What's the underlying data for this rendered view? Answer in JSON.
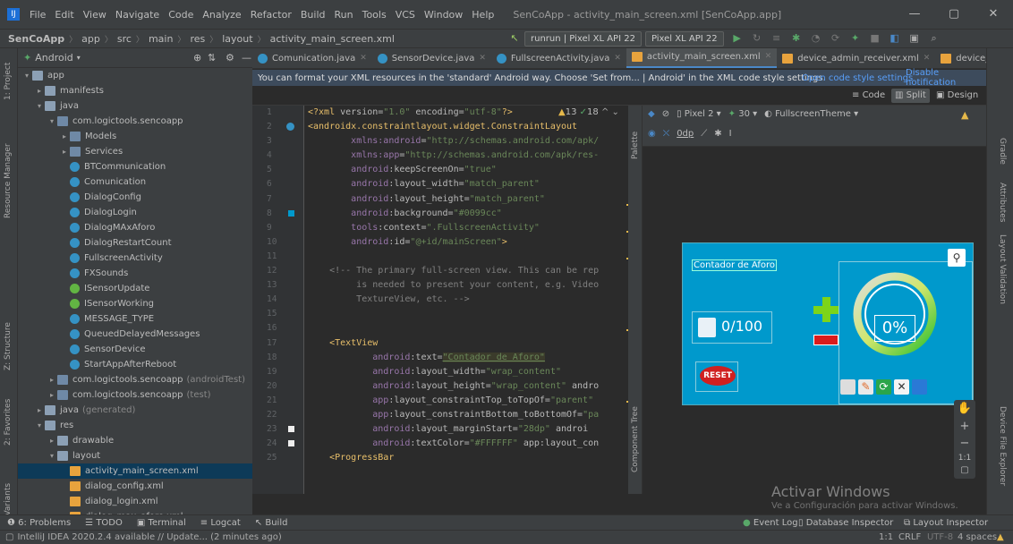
{
  "window": {
    "title": "SenCoApp - activity_main_screen.xml [SenCoApp.app]"
  },
  "menu": [
    "File",
    "Edit",
    "View",
    "Navigate",
    "Code",
    "Analyze",
    "Refactor",
    "Build",
    "Run",
    "Tools",
    "VCS",
    "Window",
    "Help"
  ],
  "breadcrumb": [
    "SenCoApp",
    "app",
    "src",
    "main",
    "res",
    "layout",
    "activity_main_screen.xml"
  ],
  "toolbar": {
    "run_config": "runrun | Pixel XL API 22",
    "device": "Pixel XL API 22"
  },
  "project_panel": {
    "view": "Android"
  },
  "tree": [
    {
      "label": "app",
      "level": 0,
      "icon": "fold",
      "arrow": "▾"
    },
    {
      "label": "manifests",
      "level": 1,
      "icon": "fold",
      "arrow": "▸"
    },
    {
      "label": "java",
      "level": 1,
      "icon": "fold",
      "arrow": "▾"
    },
    {
      "label": "com.logictools.sencoapp",
      "level": 2,
      "icon": "pkg",
      "arrow": "▾"
    },
    {
      "label": "Models",
      "level": 3,
      "icon": "pkg",
      "arrow": "▸"
    },
    {
      "label": "Services",
      "level": 3,
      "icon": "pkg",
      "arrow": "▸"
    },
    {
      "label": "BTCommunication",
      "level": 3,
      "icon": "cls",
      "arrow": ""
    },
    {
      "label": "Comunication",
      "level": 3,
      "icon": "cls",
      "arrow": ""
    },
    {
      "label": "DialogConfig",
      "level": 3,
      "icon": "cls",
      "arrow": ""
    },
    {
      "label": "DialogLogin",
      "level": 3,
      "icon": "cls",
      "arrow": ""
    },
    {
      "label": "DialogMAxAforo",
      "level": 3,
      "icon": "cls",
      "arrow": ""
    },
    {
      "label": "DialogRestartCount",
      "level": 3,
      "icon": "cls",
      "arrow": ""
    },
    {
      "label": "FullscreenActivity",
      "level": 3,
      "icon": "cls",
      "arrow": ""
    },
    {
      "label": "FXSounds",
      "level": 3,
      "icon": "cls",
      "arrow": ""
    },
    {
      "label": "ISensorUpdate",
      "level": 3,
      "icon": "itf",
      "arrow": ""
    },
    {
      "label": "ISensorWorking",
      "level": 3,
      "icon": "itf",
      "arrow": ""
    },
    {
      "label": "MESSAGE_TYPE",
      "level": 3,
      "icon": "cls",
      "arrow": ""
    },
    {
      "label": "QueuedDelayedMessages",
      "level": 3,
      "icon": "cls",
      "arrow": ""
    },
    {
      "label": "SensorDevice",
      "level": 3,
      "icon": "cls",
      "arrow": ""
    },
    {
      "label": "StartAppAfterReboot",
      "level": 3,
      "icon": "cls",
      "arrow": ""
    },
    {
      "label": "com.logictools.sencoapp",
      "suffix": "(androidTest)",
      "level": 2,
      "icon": "pkg",
      "arrow": "▸"
    },
    {
      "label": "com.logictools.sencoapp",
      "suffix": "(test)",
      "level": 2,
      "icon": "pkg",
      "arrow": "▸"
    },
    {
      "label": "java",
      "suffix": "(generated)",
      "level": 1,
      "icon": "fold",
      "arrow": "▸"
    },
    {
      "label": "res",
      "level": 1,
      "icon": "fold",
      "arrow": "▾"
    },
    {
      "label": "drawable",
      "level": 2,
      "icon": "fold",
      "arrow": "▸"
    },
    {
      "label": "layout",
      "level": 2,
      "icon": "fold",
      "arrow": "▾"
    },
    {
      "label": "activity_main_screen.xml",
      "level": 3,
      "icon": "xml",
      "arrow": "",
      "selected": true
    },
    {
      "label": "dialog_config.xml",
      "level": 3,
      "icon": "xml",
      "arrow": ""
    },
    {
      "label": "dialog_login.xml",
      "level": 3,
      "icon": "xml",
      "arrow": ""
    },
    {
      "label": "dialog_max_aforo.xml",
      "level": 3,
      "icon": "xml",
      "arrow": ""
    }
  ],
  "tabs": [
    {
      "label": "Comunication.java",
      "active": false
    },
    {
      "label": "SensorDevice.java",
      "active": false
    },
    {
      "label": "FullscreenActivity.java",
      "active": false
    },
    {
      "label": "activity_main_screen.xml",
      "active": true
    },
    {
      "label": "device_admin_receiver.xml",
      "active": false
    },
    {
      "label": "device_filter.xml",
      "active": false
    }
  ],
  "notification": {
    "text": "You can format your XML resources in the 'standard' Android way. Choose 'Set from... | Android' in the XML code style settings.",
    "open_link": "Open code style settings",
    "disable_link": "Disable notification"
  },
  "modes": [
    "Code",
    "Split",
    "Design"
  ],
  "code": {
    "line_numbers": [
      "1",
      "2",
      "3",
      "4",
      "5",
      "6",
      "7",
      "8",
      "9",
      "10",
      "11",
      "12",
      "13",
      "14",
      "15",
      "16",
      "17",
      "18",
      "19",
      "20",
      "21",
      "22",
      "23",
      "24",
      "25"
    ],
    "inspection": {
      "warnings": "13",
      "weak": "18"
    }
  },
  "design": {
    "toolbar1": {
      "pixel": "Pixel 2",
      "api": "30",
      "theme": "FullscreenTheme"
    },
    "toolbar2": {
      "margin": "0dp"
    },
    "preview": {
      "title": "Contador de Aforo",
      "counter": "0/100",
      "percent": "0%",
      "reset": "RESET",
      "progress": 0.0
    }
  },
  "side_tools_left": [
    "1: Project",
    "Resource Manager",
    "Z: Structure",
    "2: Favorites",
    "Build Variants"
  ],
  "side_tools_right": [
    "Gradle",
    "Attributes",
    "Layout Validation",
    "Device File Explorer"
  ],
  "inner_tools": [
    "Palette",
    "Component Tree"
  ],
  "zoom": [
    "+",
    "−",
    "1:1"
  ],
  "bottom_tools": [
    "6: Problems",
    "TODO",
    "Terminal",
    "Logcat",
    "Build"
  ],
  "bottom_right": [
    "Event Log",
    "Database Inspector",
    "Layout Inspector"
  ],
  "status": {
    "text": "IntelliJ IDEA 2020.2.4 available // Update... (2 minutes ago)",
    "position": "1:1",
    "lineSep": "CRLF",
    "encoding": "UTF-8",
    "indent": "4 spaces"
  },
  "watermark": {
    "title": "Activar Windows",
    "subtitle": "Ve a Configuración para activar Windows."
  },
  "colors": {
    "accent": "#4a88c7",
    "preview_bg": "#0099cc",
    "xml_tag": "#e8bf6a",
    "xml_value": "#6a8759"
  }
}
